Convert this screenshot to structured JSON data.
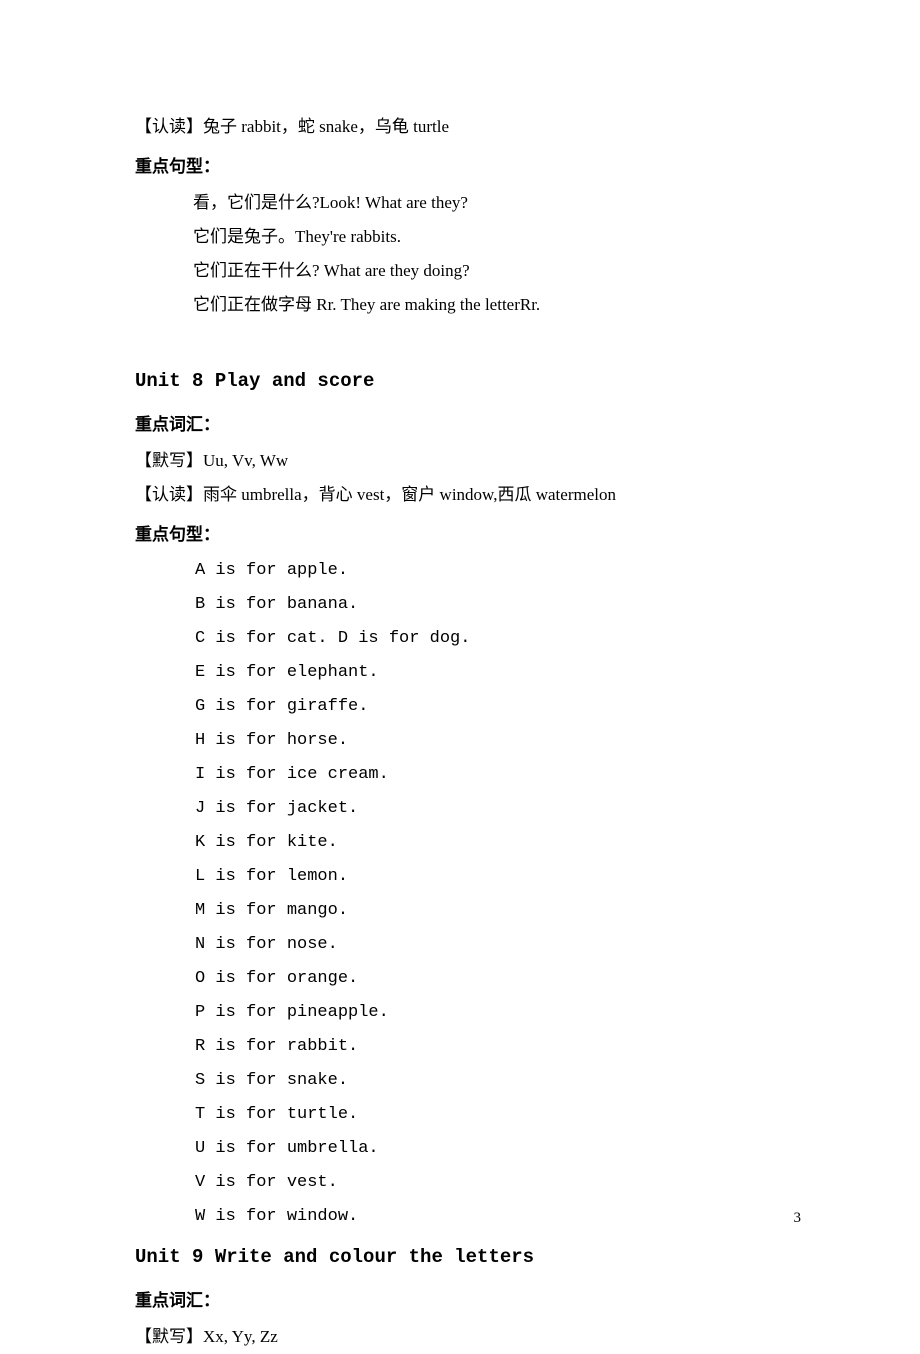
{
  "line1": "【认读】兔子 rabbit，蛇 snake，乌龟 turtle",
  "section1_label": "重点句型：",
  "s1_l1": "看，它们是什么?Look! What are they?",
  "s1_l2": "它们是兔子。They're rabbits.",
  "s1_l3": "它们正在干什么? What are they doing?",
  "s1_l4": "它们正在做字母 Rr. They are making the letterRr.",
  "unit8_heading": "Unit 8 Play and score",
  "u8_vocab_label": "重点词汇：",
  "u8_moxie": "【默写】Uu, Vv, Ww",
  "u8_rendu": "【认读】雨伞 umbrella，背心 vest，窗户 window,西瓜 watermelon",
  "u8_sentence_label": "重点句型：",
  "abc": {
    "a": "A is for apple.",
    "b": "B is for banana.",
    "c": "C is for cat. D is for dog.",
    "e": "E is for elephant.",
    "g": "G is for giraffe.",
    "h": "H is for horse.",
    "i": "I is for ice cream.",
    "j": "J is for jacket.",
    "k": "K is for kite.",
    "l": "L is for lemon.",
    "m": "M is for mango.",
    "n": "N is for nose.",
    "o": "O is for orange.",
    "p": "P is for pineapple.",
    "r": "R is for rabbit.",
    "s": "S is for snake.",
    "t": "T is for turtle.",
    "u": "U is for umbrella.",
    "v": "V is for vest.",
    "w": "W is for window."
  },
  "unit9_heading": "Unit 9  Write and colour the letters",
  "u9_vocab_label": "重点词汇：",
  "u9_moxie": "【默写】Xx, Yy, Zz",
  "page_number": "3"
}
